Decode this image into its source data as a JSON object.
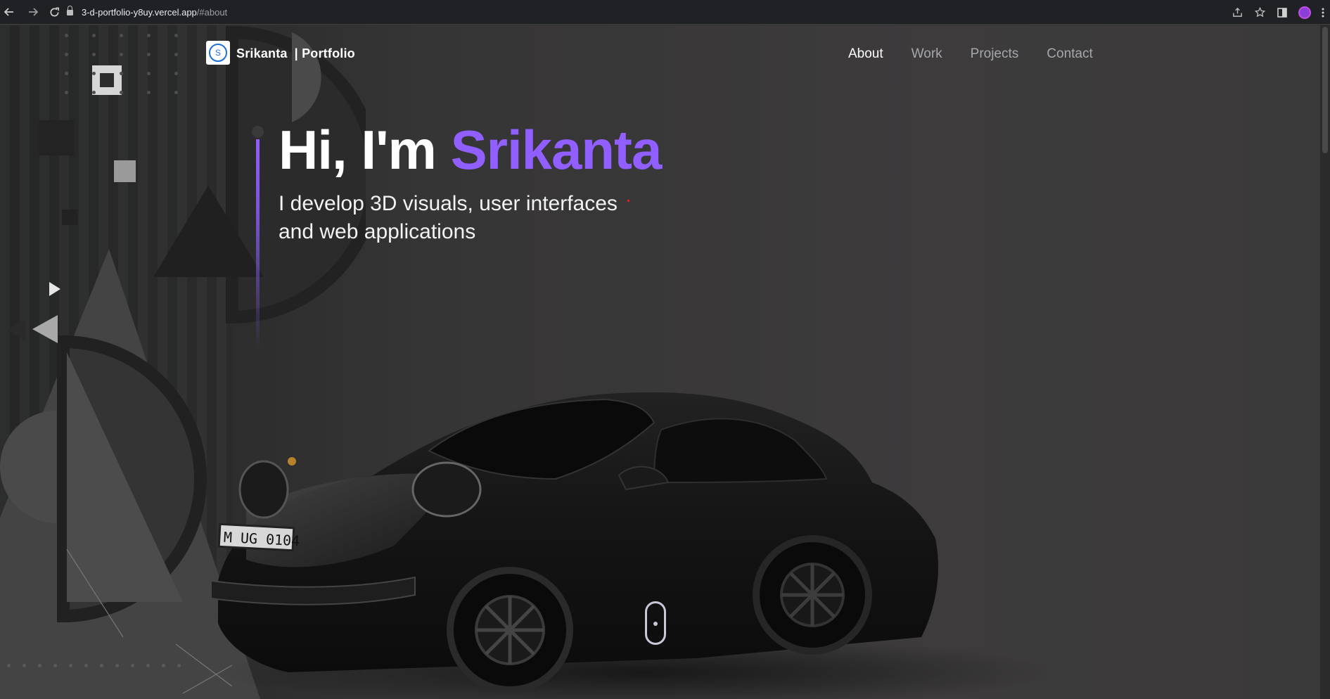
{
  "browser": {
    "url_host": "3-d-portfolio-y8uy.vercel.app",
    "url_path": "/#about",
    "back_icon": "arrow-left-icon",
    "forward_icon": "arrow-right-icon",
    "reload_icon": "reload-icon"
  },
  "brand": {
    "logo_letter": "S",
    "name": "Srikanta",
    "suffix": "| Portfolio"
  },
  "nav": {
    "items": [
      {
        "label": "About",
        "active": true
      },
      {
        "label": "Work",
        "active": false
      },
      {
        "label": "Projects",
        "active": false
      },
      {
        "label": "Contact",
        "active": false
      }
    ]
  },
  "hero": {
    "greeting": "Hi, I'm ",
    "name": "Srikanta",
    "subtitle": "I develop 3D visuals, user interfaces and web applications"
  },
  "car": {
    "plate": "M UG 0104"
  },
  "colors": {
    "accent": "#915eff",
    "background": "#363535",
    "nav_inactive": "#a6a6ad"
  }
}
